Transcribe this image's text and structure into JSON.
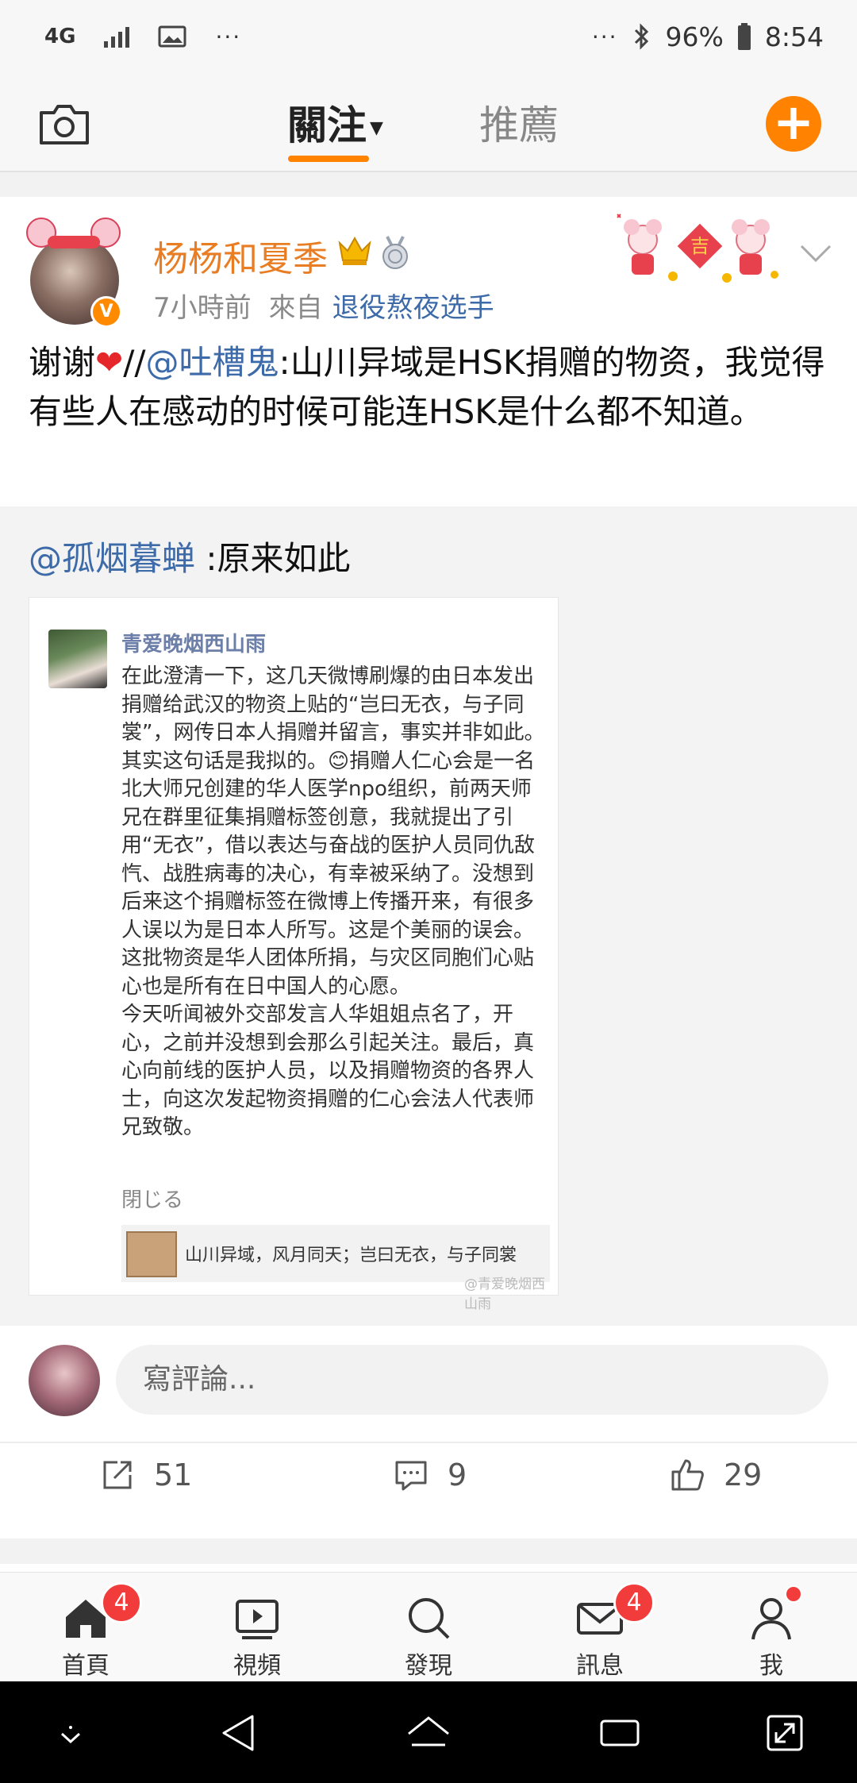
{
  "status_bar": {
    "network": "4G",
    "dots_left": "···",
    "dots_right": "···",
    "battery": "96%",
    "time": "8:54"
  },
  "top_nav": {
    "follow_tab": "關注",
    "recommend_tab": "推薦",
    "accent_color": "#ff8200"
  },
  "post": {
    "username": "杨杨和夏季",
    "time": "7小時前",
    "from_label": "來自",
    "source": "退役熬夜选手",
    "text_prefix": "谢谢",
    "heart": "❤",
    "slashes": "//",
    "mention": "@吐槽鬼",
    "text_body": ":山川异域是HSK捐赠的物资，我觉得有些人在感动的时候可能连HSK是什么都不知道。",
    "retweet": {
      "mention": "@孤烟暮蝉",
      "text": " :原来如此",
      "screenshot": {
        "name": "青爱晚烟西山雨",
        "body": "在此澄清一下，这几天微博刷爆的由日本发出捐赠给武汉的物资上贴的“岂曰无衣，与子同裳”，网传日本人捐赠并留言，事实并非如此。其实这句话是我拟的。😊捐赠人仁心会是一名北大师兄创建的华人医学npo组织，前两天师兄在群里征集捐赠标签创意，我就提出了引用“无衣”，借以表达与奋战的医护人员同仇敌忾、战胜病毒的决心，有幸被采纳了。没想到后来这个捐赠标签在微博上传播开来，有很多人误以为是日本人所写。这是个美丽的误会。这批物资是华人团体所捐，与灾区同胞们心贴心也是所有在日中国人的心愿。\n今天听闻被外交部发言人华姐姐点名了，开心，之前并没想到会那么引起关注。最后，真心向前线的医护人员，以及捐赠物资的各界人士，向这次发起物资捐赠的仁心会法人代表师兄致敬。",
        "close": "閉じる",
        "link_text": "山川异域，风月同天；岂曰无衣，与子同裳",
        "watermark": "@青爱晚烟西山雨"
      }
    },
    "comment_placeholder": "寫評論...",
    "reposts": "51",
    "comments": "9",
    "likes": "29"
  },
  "tabbar": {
    "home": "首頁",
    "home_badge": "4",
    "video": "視頻",
    "discover": "發現",
    "messages": "訊息",
    "messages_badge": "4",
    "me": "我"
  },
  "icons": [
    "camera-icon",
    "add-icon",
    "crown-icon",
    "medal-icon",
    "chevron-down-icon",
    "repost-icon",
    "comment-icon",
    "like-icon",
    "home-icon",
    "video-icon",
    "search-icon",
    "mail-icon",
    "person-icon",
    "back-icon",
    "home-nav-icon",
    "recents-icon"
  ]
}
